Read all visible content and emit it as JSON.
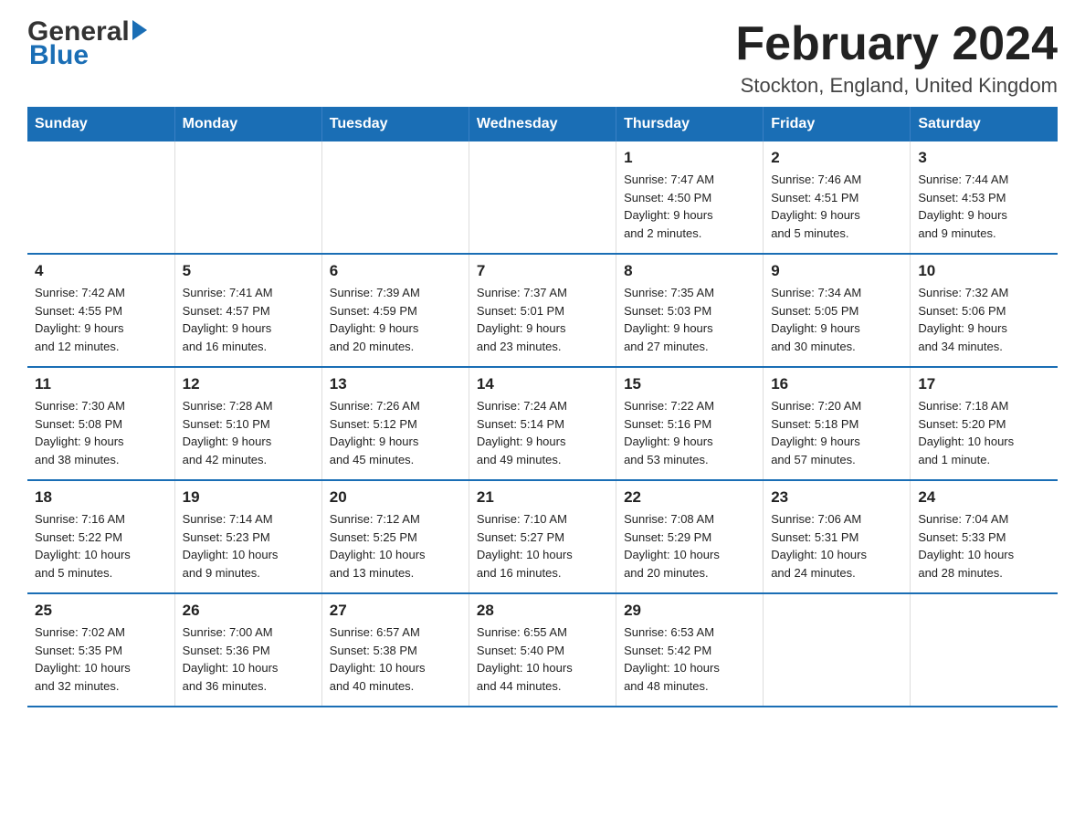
{
  "header": {
    "logo_general": "General",
    "logo_blue": "Blue",
    "title": "February 2024",
    "location": "Stockton, England, United Kingdom"
  },
  "calendar": {
    "days_of_week": [
      "Sunday",
      "Monday",
      "Tuesday",
      "Wednesday",
      "Thursday",
      "Friday",
      "Saturday"
    ],
    "weeks": [
      [
        {
          "day": "",
          "info": ""
        },
        {
          "day": "",
          "info": ""
        },
        {
          "day": "",
          "info": ""
        },
        {
          "day": "",
          "info": ""
        },
        {
          "day": "1",
          "info": "Sunrise: 7:47 AM\nSunset: 4:50 PM\nDaylight: 9 hours\nand 2 minutes."
        },
        {
          "day": "2",
          "info": "Sunrise: 7:46 AM\nSunset: 4:51 PM\nDaylight: 9 hours\nand 5 minutes."
        },
        {
          "day": "3",
          "info": "Sunrise: 7:44 AM\nSunset: 4:53 PM\nDaylight: 9 hours\nand 9 minutes."
        }
      ],
      [
        {
          "day": "4",
          "info": "Sunrise: 7:42 AM\nSunset: 4:55 PM\nDaylight: 9 hours\nand 12 minutes."
        },
        {
          "day": "5",
          "info": "Sunrise: 7:41 AM\nSunset: 4:57 PM\nDaylight: 9 hours\nand 16 minutes."
        },
        {
          "day": "6",
          "info": "Sunrise: 7:39 AM\nSunset: 4:59 PM\nDaylight: 9 hours\nand 20 minutes."
        },
        {
          "day": "7",
          "info": "Sunrise: 7:37 AM\nSunset: 5:01 PM\nDaylight: 9 hours\nand 23 minutes."
        },
        {
          "day": "8",
          "info": "Sunrise: 7:35 AM\nSunset: 5:03 PM\nDaylight: 9 hours\nand 27 minutes."
        },
        {
          "day": "9",
          "info": "Sunrise: 7:34 AM\nSunset: 5:05 PM\nDaylight: 9 hours\nand 30 minutes."
        },
        {
          "day": "10",
          "info": "Sunrise: 7:32 AM\nSunset: 5:06 PM\nDaylight: 9 hours\nand 34 minutes."
        }
      ],
      [
        {
          "day": "11",
          "info": "Sunrise: 7:30 AM\nSunset: 5:08 PM\nDaylight: 9 hours\nand 38 minutes."
        },
        {
          "day": "12",
          "info": "Sunrise: 7:28 AM\nSunset: 5:10 PM\nDaylight: 9 hours\nand 42 minutes."
        },
        {
          "day": "13",
          "info": "Sunrise: 7:26 AM\nSunset: 5:12 PM\nDaylight: 9 hours\nand 45 minutes."
        },
        {
          "day": "14",
          "info": "Sunrise: 7:24 AM\nSunset: 5:14 PM\nDaylight: 9 hours\nand 49 minutes."
        },
        {
          "day": "15",
          "info": "Sunrise: 7:22 AM\nSunset: 5:16 PM\nDaylight: 9 hours\nand 53 minutes."
        },
        {
          "day": "16",
          "info": "Sunrise: 7:20 AM\nSunset: 5:18 PM\nDaylight: 9 hours\nand 57 minutes."
        },
        {
          "day": "17",
          "info": "Sunrise: 7:18 AM\nSunset: 5:20 PM\nDaylight: 10 hours\nand 1 minute."
        }
      ],
      [
        {
          "day": "18",
          "info": "Sunrise: 7:16 AM\nSunset: 5:22 PM\nDaylight: 10 hours\nand 5 minutes."
        },
        {
          "day": "19",
          "info": "Sunrise: 7:14 AM\nSunset: 5:23 PM\nDaylight: 10 hours\nand 9 minutes."
        },
        {
          "day": "20",
          "info": "Sunrise: 7:12 AM\nSunset: 5:25 PM\nDaylight: 10 hours\nand 13 minutes."
        },
        {
          "day": "21",
          "info": "Sunrise: 7:10 AM\nSunset: 5:27 PM\nDaylight: 10 hours\nand 16 minutes."
        },
        {
          "day": "22",
          "info": "Sunrise: 7:08 AM\nSunset: 5:29 PM\nDaylight: 10 hours\nand 20 minutes."
        },
        {
          "day": "23",
          "info": "Sunrise: 7:06 AM\nSunset: 5:31 PM\nDaylight: 10 hours\nand 24 minutes."
        },
        {
          "day": "24",
          "info": "Sunrise: 7:04 AM\nSunset: 5:33 PM\nDaylight: 10 hours\nand 28 minutes."
        }
      ],
      [
        {
          "day": "25",
          "info": "Sunrise: 7:02 AM\nSunset: 5:35 PM\nDaylight: 10 hours\nand 32 minutes."
        },
        {
          "day": "26",
          "info": "Sunrise: 7:00 AM\nSunset: 5:36 PM\nDaylight: 10 hours\nand 36 minutes."
        },
        {
          "day": "27",
          "info": "Sunrise: 6:57 AM\nSunset: 5:38 PM\nDaylight: 10 hours\nand 40 minutes."
        },
        {
          "day": "28",
          "info": "Sunrise: 6:55 AM\nSunset: 5:40 PM\nDaylight: 10 hours\nand 44 minutes."
        },
        {
          "day": "29",
          "info": "Sunrise: 6:53 AM\nSunset: 5:42 PM\nDaylight: 10 hours\nand 48 minutes."
        },
        {
          "day": "",
          "info": ""
        },
        {
          "day": "",
          "info": ""
        }
      ]
    ]
  }
}
